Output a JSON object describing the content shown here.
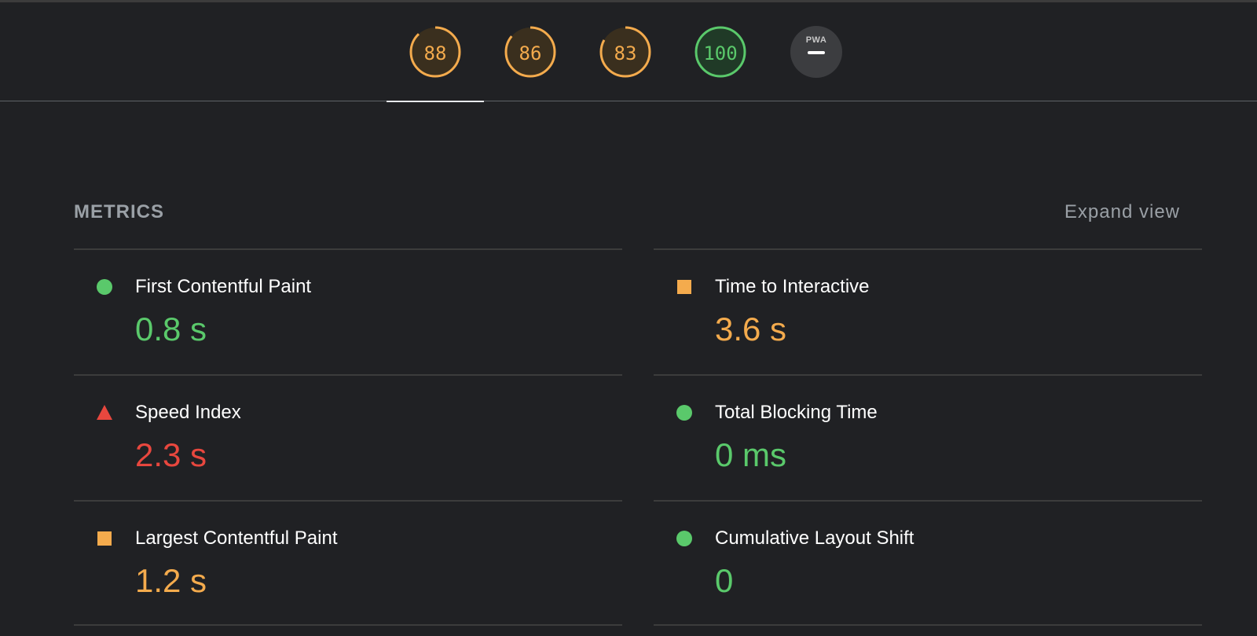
{
  "colors": {
    "pass": "#5ac96b",
    "average": "#f4ab4d",
    "fail": "#e8473e",
    "neutral": "#3c3d40"
  },
  "gauges": [
    {
      "label": "88",
      "score": 88,
      "status": "average",
      "active": true
    },
    {
      "label": "86",
      "score": 86,
      "status": "average",
      "active": false
    },
    {
      "label": "83",
      "score": 83,
      "status": "average",
      "active": false
    },
    {
      "label": "100",
      "score": 100,
      "status": "pass",
      "active": false
    }
  ],
  "pwa": {
    "badge_text": "PWA"
  },
  "metrics": {
    "header": "METRICS",
    "expand_label": "Expand view",
    "left": [
      {
        "title": "First Contentful Paint",
        "value": "0.8 s",
        "status": "pass",
        "icon": "circle-icon"
      },
      {
        "title": "Speed Index",
        "value": "2.3 s",
        "status": "fail",
        "icon": "triangle-icon"
      },
      {
        "title": "Largest Contentful Paint",
        "value": "1.2 s",
        "status": "average",
        "icon": "square-icon"
      }
    ],
    "right": [
      {
        "title": "Time to Interactive",
        "value": "3.6 s",
        "status": "average",
        "icon": "square-icon"
      },
      {
        "title": "Total Blocking Time",
        "value": "0 ms",
        "status": "pass",
        "icon": "circle-icon"
      },
      {
        "title": "Cumulative Layout Shift",
        "value": "0",
        "status": "pass",
        "icon": "circle-icon"
      }
    ]
  }
}
